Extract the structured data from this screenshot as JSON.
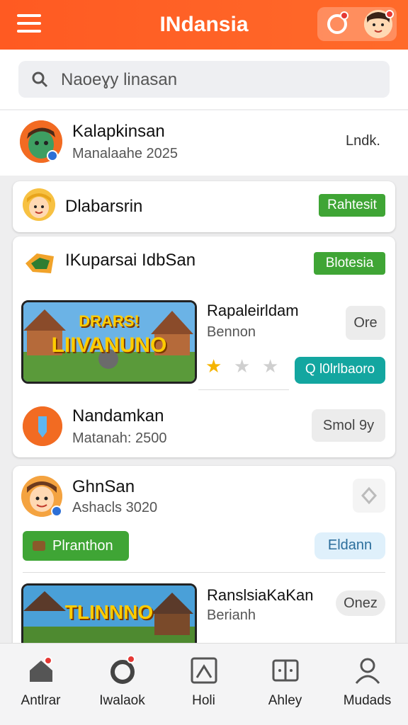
{
  "header": {
    "title": "INdansia",
    "notification_count": "1",
    "avatar_count": "1"
  },
  "search": {
    "placeholder": "Naoeɣy linasan"
  },
  "row1": {
    "title": "Kalapkinsan",
    "subtitle": "Manalaahe 2025",
    "action": "Lndk."
  },
  "card1": {
    "title": "Dlabarsrin",
    "button": "Rahtesit"
  },
  "card2": {
    "title": "IKuparsai IdbSan",
    "button": "Blotesia",
    "game": {
      "thumb_text_top": "DRARS!",
      "thumb_text": "LIIVANUNO",
      "title": "Rapaleirldam",
      "subtitle": "Bennon",
      "side_button": "Ore",
      "action_button": "Q l0lrlbaoro",
      "rating": 1
    },
    "item": {
      "title": "Nandamkan",
      "subtitle": "Matanah: 2500",
      "button": "Smol 9y"
    }
  },
  "card3": {
    "title": "GhnSan",
    "subtitle": "Ashacls 3020",
    "button_green": "Plranthon",
    "button_blue": "Eldann",
    "game": {
      "thumb_text": "TLINNNO",
      "title": "RanslsiaKaKan",
      "subtitle": "Berianh",
      "side_button": "Onez"
    }
  },
  "nav": {
    "items": [
      {
        "label": "Antlrar",
        "icon": "home-icon",
        "badge": "1"
      },
      {
        "label": "Iwalaok",
        "icon": "circle-icon",
        "badge": "1"
      },
      {
        "label": "Holi",
        "icon": "image-icon"
      },
      {
        "label": "Ahley",
        "icon": "cards-icon"
      },
      {
        "label": "Mudads",
        "icon": "user-icon"
      }
    ]
  },
  "colors": {
    "accent": "#ff5a22",
    "green": "#3fa535",
    "teal": "#13a6a0",
    "star": "#f5b400"
  }
}
